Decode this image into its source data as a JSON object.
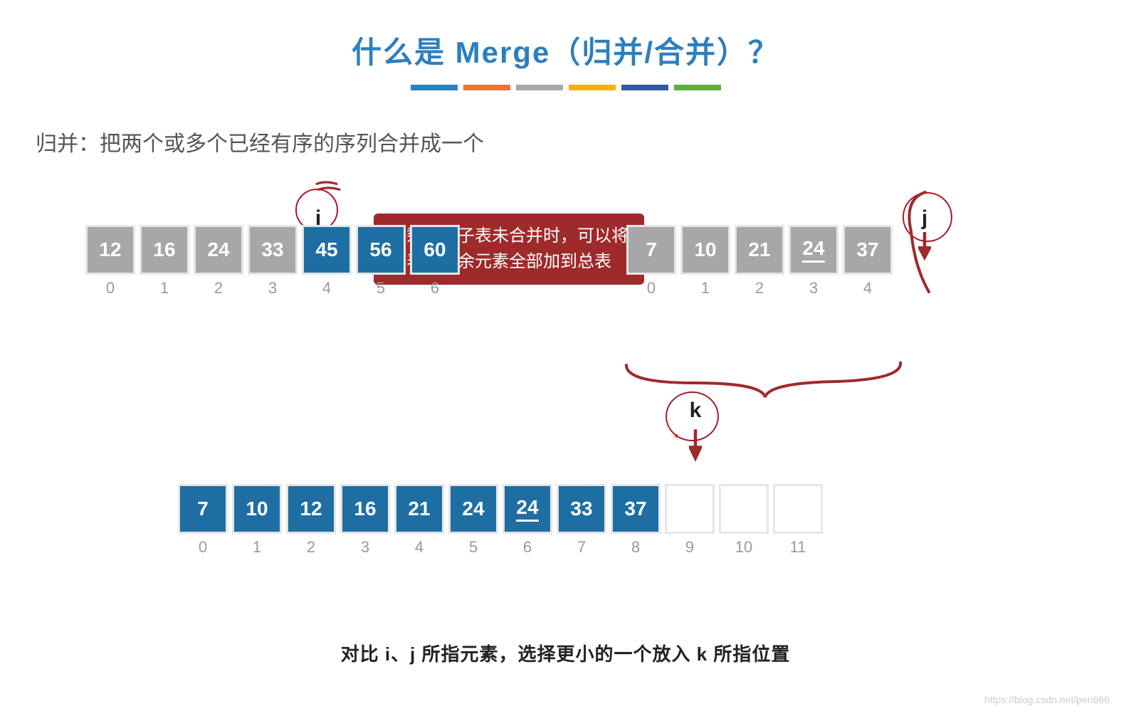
{
  "title": "什么是 Merge（归并/合并）？",
  "subtitle": "归并：把两个或多个已经有序的序列合并成一个",
  "color_bars": [
    "#2c7fbf",
    "#e8743b",
    "#a7a7a7",
    "#f2b20e",
    "#3358a0",
    "#5fae41"
  ],
  "pointers": {
    "i": "i",
    "j": "j",
    "k": "k"
  },
  "callout": {
    "line1": "只剩一个子表未合并时，可以将",
    "line2": "该表中剩余元素全部加到总表"
  },
  "array_left": [
    {
      "val": "12",
      "bg": "gray",
      "idx": "0"
    },
    {
      "val": "16",
      "bg": "gray",
      "idx": "1"
    },
    {
      "val": "24",
      "bg": "gray",
      "idx": "2"
    },
    {
      "val": "33",
      "bg": "gray",
      "idx": "3"
    },
    {
      "val": "45",
      "bg": "blue",
      "idx": "4"
    },
    {
      "val": "56",
      "bg": "blue",
      "idx": "5"
    },
    {
      "val": "60",
      "bg": "blue",
      "idx": "6"
    }
  ],
  "array_right": [
    {
      "val": "7",
      "bg": "gray",
      "idx": "0"
    },
    {
      "val": "10",
      "bg": "gray",
      "idx": "1"
    },
    {
      "val": "21",
      "bg": "gray",
      "idx": "2"
    },
    {
      "val": "24",
      "bg": "gray",
      "idx": "3",
      "underline": true
    },
    {
      "val": "37",
      "bg": "gray",
      "idx": "4"
    }
  ],
  "array_result": [
    {
      "val": "7",
      "bg": "blue",
      "idx": "0"
    },
    {
      "val": "10",
      "bg": "blue",
      "idx": "1"
    },
    {
      "val": "12",
      "bg": "blue",
      "idx": "2"
    },
    {
      "val": "16",
      "bg": "blue",
      "idx": "3"
    },
    {
      "val": "21",
      "bg": "blue",
      "idx": "4"
    },
    {
      "val": "24",
      "bg": "blue",
      "idx": "5"
    },
    {
      "val": "24",
      "bg": "blue",
      "idx": "6",
      "underline": true
    },
    {
      "val": "33",
      "bg": "blue",
      "idx": "7"
    },
    {
      "val": "37",
      "bg": "blue",
      "idx": "8"
    },
    {
      "val": "",
      "bg": "white",
      "idx": "9"
    },
    {
      "val": "",
      "bg": "white",
      "idx": "10"
    },
    {
      "val": "",
      "bg": "white",
      "idx": "11"
    }
  ],
  "bottom_text": "对比 i、j 所指元素，选择更小的一个放入 k 所指位置",
  "watermark": "https://blog.csdn.net/peri666"
}
